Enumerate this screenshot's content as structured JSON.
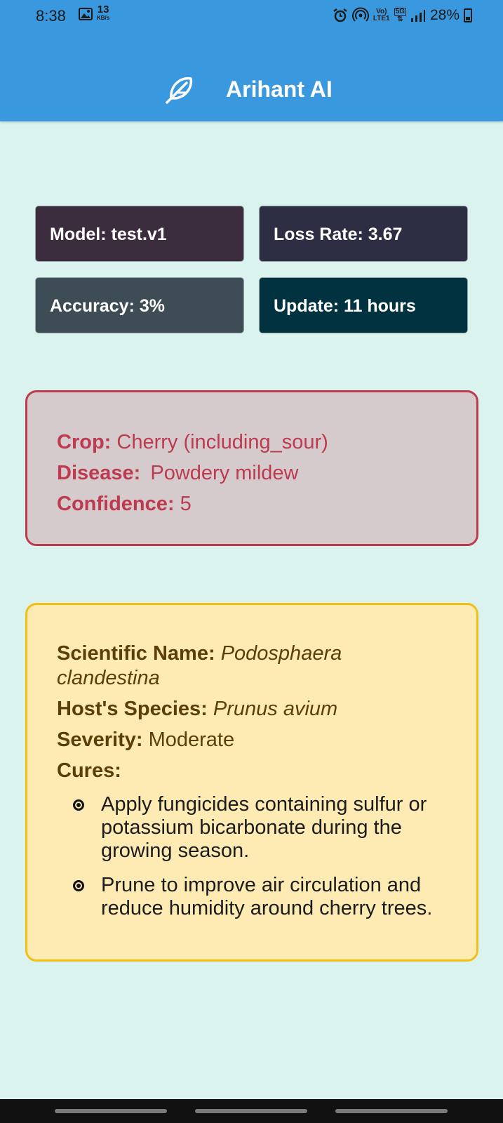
{
  "status_bar": {
    "time": "8:38",
    "net_speed": "13",
    "net_speed_unit": "KB/s",
    "volte_line1": "Vo)",
    "volte_line2": "LTE1",
    "network": "5G",
    "battery_pct": "28%"
  },
  "header": {
    "title": "Arihant AI",
    "logo_icon": "feather-icon",
    "background": "#3a99de"
  },
  "stats": {
    "model": "Model: test.v1",
    "loss_rate": "Loss Rate: 3.67",
    "accuracy": "Accuracy: 3%",
    "update": "Update: 11 hours"
  },
  "diagnosis": {
    "crop_label": "Crop:",
    "crop_value": "Cherry (including_sour)",
    "disease_label": "Disease:",
    "disease_value": "Powdery mildew",
    "confidence_label": "Confidence:",
    "confidence_value": "5",
    "accent_color": "#bd3a50"
  },
  "details": {
    "scientific_label": "Scientific Name:",
    "scientific_value": "Podosphaera clandestina",
    "host_label": "Host's Species:",
    "host_value": "Prunus avium",
    "severity_label": "Severity:",
    "severity_value": "Moderate",
    "cures_label": "Cures:",
    "cures": [
      "Apply fungicides containing sulfur or potassium bicarbonate during the growing season.",
      "Prune to improve air circulation and reduce humidity around cherry trees."
    ],
    "accent_color": "#f2bf17"
  }
}
